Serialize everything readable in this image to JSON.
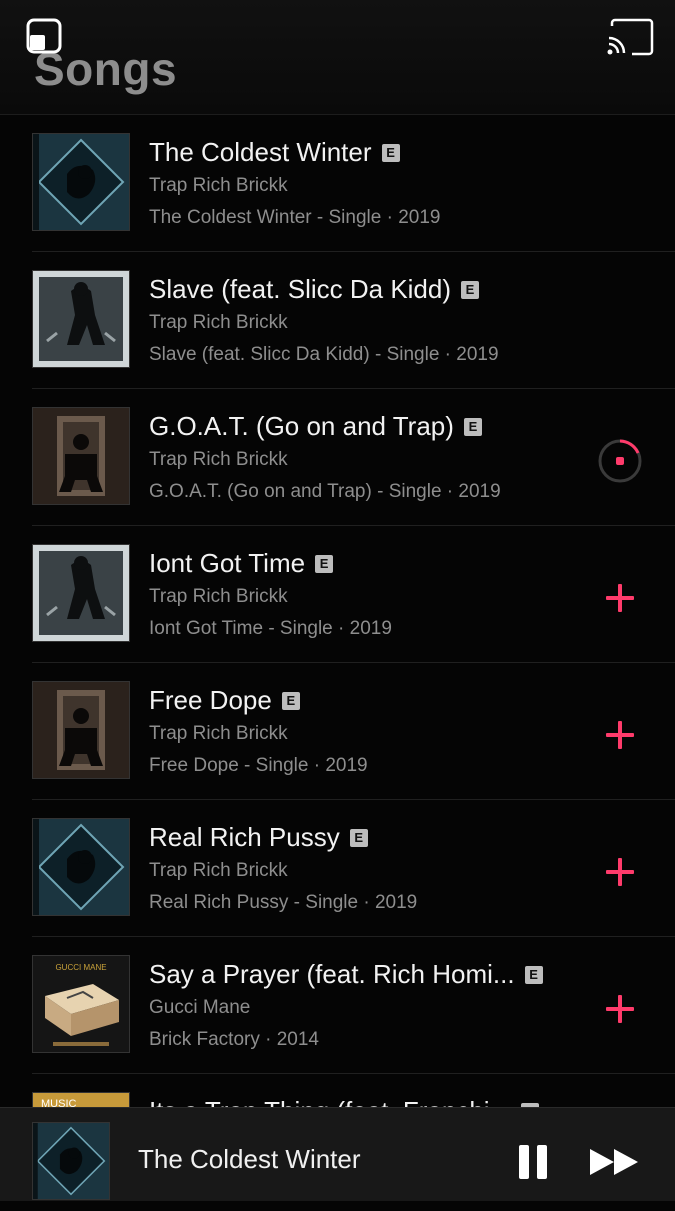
{
  "header": {
    "title": "Songs"
  },
  "colors": {
    "accent": "#ff3b6b",
    "background": "#050505",
    "secondary_text": "#8e8e8e"
  },
  "songs": [
    {
      "title": "The Coldest Winter",
      "explicit": "E",
      "artist": "Trap Rich Brickk",
      "album": "The Coldest Winter - Single · 2019",
      "action": "none",
      "art": "art-diamond"
    },
    {
      "title": "Slave (feat. Slicc Da Kidd)",
      "explicit": "E",
      "artist": "Trap Rich Brickk",
      "album": "Slave (feat. Slicc Da Kidd) - Single · 2019",
      "action": "none",
      "art": "art-sitting"
    },
    {
      "title": "G.O.A.T. (Go on and Trap)",
      "explicit": "E",
      "artist": "Trap Rich Brickk",
      "album": "G.O.A.T. (Go on and Trap) - Single · 2019",
      "action": "downloading",
      "art": "art-throne"
    },
    {
      "title": "Iont Got Time",
      "explicit": "E",
      "artist": "Trap Rich Brickk",
      "album": "Iont Got Time - Single · 2019",
      "action": "add",
      "art": "art-sitting"
    },
    {
      "title": "Free Dope",
      "explicit": "E",
      "artist": "Trap Rich Brickk",
      "album": "Free Dope - Single · 2019",
      "action": "add",
      "art": "art-throne"
    },
    {
      "title": "Real Rich Pussy",
      "explicit": "E",
      "artist": "Trap Rich Brickk",
      "album": "Real Rich Pussy - Single · 2019",
      "action": "add",
      "art": "art-diamond"
    },
    {
      "title": "Say a Prayer (feat. Rich Homi...",
      "explicit": "E",
      "artist": "Gucci Mane",
      "album": "Brick Factory · 2014",
      "action": "add",
      "art": "art-box"
    }
  ],
  "partial_song": {
    "title": "Its a Trap Thing (feat. Franchi...",
    "explicit": "E"
  },
  "mini_player": {
    "title": "The Coldest Winter",
    "art": "art-diamond"
  }
}
